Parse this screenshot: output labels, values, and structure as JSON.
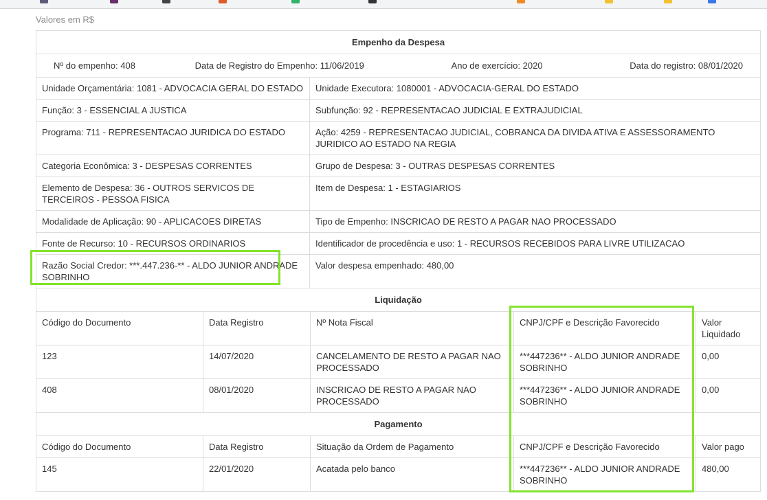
{
  "caption": "Valores em R$",
  "empenho": {
    "title": "Empenho da Despesa",
    "numero": "Nº do empenho: 408",
    "data_registro_empenho": "Data de Registro do Empenho: 11/06/2019",
    "ano_exercicio": "Ano de exercício: 2020",
    "data_registro": "Data do registro: 08/01/2020",
    "rows": [
      [
        "Unidade Orçamentária: 1081 - ADVOCACIA GERAL DO ESTADO",
        "Unidade Executora: 1080001 - ADVOCACIA-GERAL DO ESTADO"
      ],
      [
        "Função: 3 - ESSENCIAL A JUSTICA",
        "Subfunção: 92 - REPRESENTACAO JUDICIAL E EXTRAJUDICIAL"
      ],
      [
        "Programa: 711 - REPRESENTACAO JURIDICA DO ESTADO",
        "Ação: 4259 - REPRESENTACAO JUDICIAL, COBRANCA DA DIVIDA ATIVA E ASSESSORAMENTO JURIDICO AO ESTADO NA REGIA"
      ],
      [
        "Categoria Econômica: 3 - DESPESAS CORRENTES",
        "Grupo de Despesa: 3 - OUTRAS DESPESAS CORRENTES"
      ],
      [
        "Elemento de Despesa: 36 - OUTROS SERVICOS DE TERCEIROS - PESSOA FISICA",
        "Item de Despesa: 1 - ESTAGIARIOS"
      ],
      [
        "Modalidade de Aplicação: 90 - APLICACOES DIRETAS",
        "Tipo de Empenho: INSCRICAO DE RESTO A PAGAR NAO PROCESSADO"
      ],
      [
        "Fonte de Recurso: 10 - RECURSOS ORDINARIOS",
        "Identificador de procedência e uso: 1 - RECURSOS RECEBIDOS PARA LIVRE UTILIZACAO"
      ],
      [
        "Razão Social Credor: ***.447.236-** - ALDO JUNIOR ANDRADE SOBRINHO",
        "Valor despesa empenhado: 480,00"
      ]
    ]
  },
  "liquidacao": {
    "title": "Liquidação",
    "headers": [
      "Código do Documento",
      "Data Registro",
      "Nº Nota Fiscal",
      "CNPJ/CPF e Descrição Favorecido",
      "Valor Liquidado"
    ],
    "rows": [
      [
        "123",
        "14/07/2020",
        "CANCELAMENTO DE RESTO A PAGAR NAO PROCESSADO",
        "***447236** - ALDO JUNIOR ANDRADE SOBRINHO",
        "0,00"
      ],
      [
        "408",
        "08/01/2020",
        "INSCRICAO DE RESTO A PAGAR NAO PROCESSADO",
        "***447236** - ALDO JUNIOR ANDRADE SOBRINHO",
        "0,00"
      ]
    ]
  },
  "pagamento": {
    "title": "Pagamento",
    "headers": [
      "Código do Documento",
      "Data Registro",
      "Situação da Ordem de Pagamento",
      "CNPJ/CPF e Descrição Favorecido",
      "Valor pago"
    ],
    "rows": [
      [
        "145",
        "22/01/2020",
        "Acatada pelo banco",
        "***447236** - ALDO JUNIOR ANDRADE SOBRINHO",
        "480,00"
      ]
    ]
  },
  "highlight_color": "#84e32c"
}
